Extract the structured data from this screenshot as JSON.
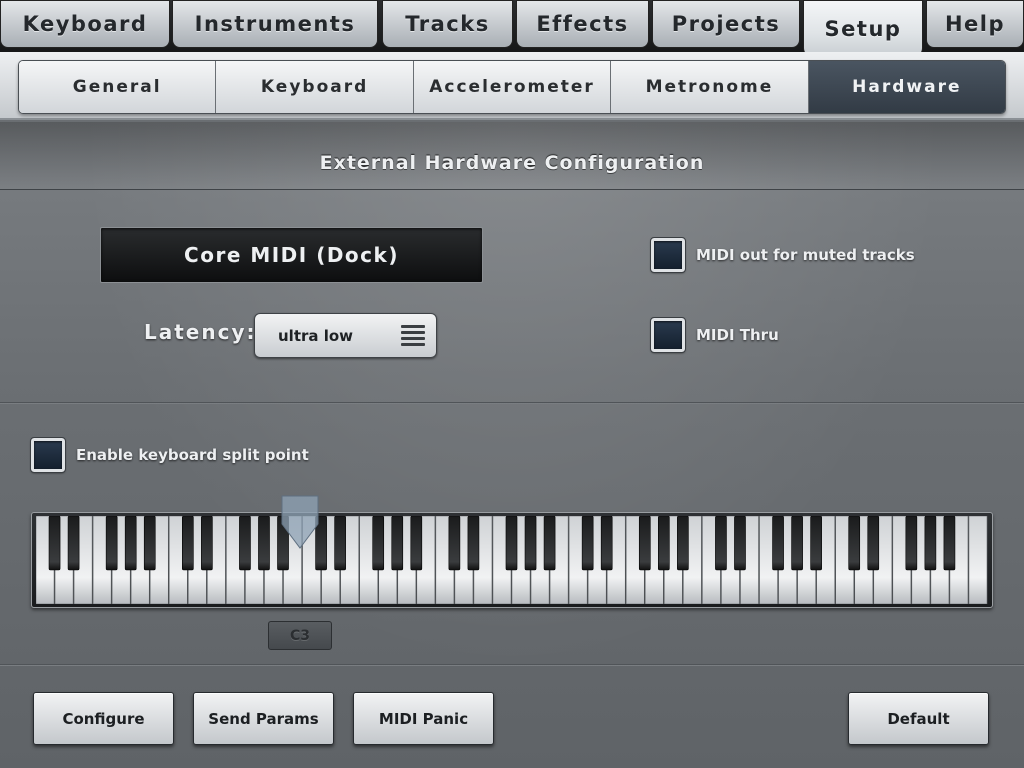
{
  "top_tabs": [
    {
      "label": "Keyboard",
      "active": false
    },
    {
      "label": "Instruments",
      "active": false
    },
    {
      "label": "Tracks",
      "active": false
    },
    {
      "label": "Effects",
      "active": false
    },
    {
      "label": "Projects",
      "active": false
    },
    {
      "label": "Setup",
      "active": true
    },
    {
      "label": "Help",
      "active": false
    }
  ],
  "sub_tabs": [
    {
      "label": "General",
      "active": false
    },
    {
      "label": "Keyboard",
      "active": false
    },
    {
      "label": "Accelerometer",
      "active": false
    },
    {
      "label": "Metronome",
      "active": false
    },
    {
      "label": "Hardware",
      "active": true
    }
  ],
  "section": {
    "title": "External Hardware Configuration"
  },
  "midi_port": {
    "label": "Core MIDI (Dock)"
  },
  "latency": {
    "label": "Latency:",
    "value": "ultra low"
  },
  "options": {
    "midi_out_muted": {
      "label": "MIDI out for muted tracks",
      "checked": false
    },
    "midi_thru": {
      "label": "MIDI Thru",
      "checked": false
    }
  },
  "split": {
    "label": "Enable keyboard split point",
    "checked": false,
    "note": "C3"
  },
  "buttons": {
    "configure": "Configure",
    "send_params": "Send Params",
    "midi_panic": "MIDI Panic",
    "default": "Default"
  },
  "colors": {
    "active_subtab": "#3a444e",
    "panel": "#6b6f73",
    "checkbox_fill": "#1c2a3a"
  },
  "icons": {
    "latency_menu": "hamburger-menu-icon",
    "split_marker": "split-point-marker"
  }
}
